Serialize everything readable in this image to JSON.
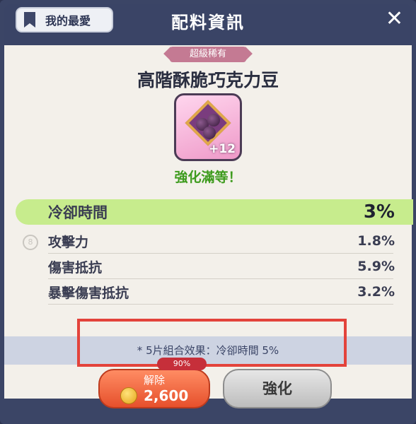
{
  "header": {
    "favorite_label": "我的最愛",
    "title": "配料資訊",
    "close_icon": "close-icon"
  },
  "item": {
    "rarity": "超級稀有",
    "name": "高階酥脆巧克力豆",
    "level": "+12",
    "status": "強化滿等！"
  },
  "stats": {
    "main": {
      "name": "冷卻時間",
      "value": "3%"
    },
    "sub": [
      {
        "name": "攻擊力",
        "value": "1.8%"
      },
      {
        "name": "傷害抵抗",
        "value": "5.9%"
      },
      {
        "name": "暴擊傷害抵抗",
        "value": "3.2%"
      }
    ]
  },
  "set_effect": "* 5片組合效果：冷卻時間 5%",
  "badge": "90%",
  "buttons": {
    "release_label": "解除",
    "release_cost": "2,600",
    "enhance_label": "強化"
  },
  "colors": {
    "highlight": "#c7ec8d",
    "maxed_text": "#3e9b1e",
    "red_box": "#e3433b",
    "release_button": "#e6502c"
  }
}
